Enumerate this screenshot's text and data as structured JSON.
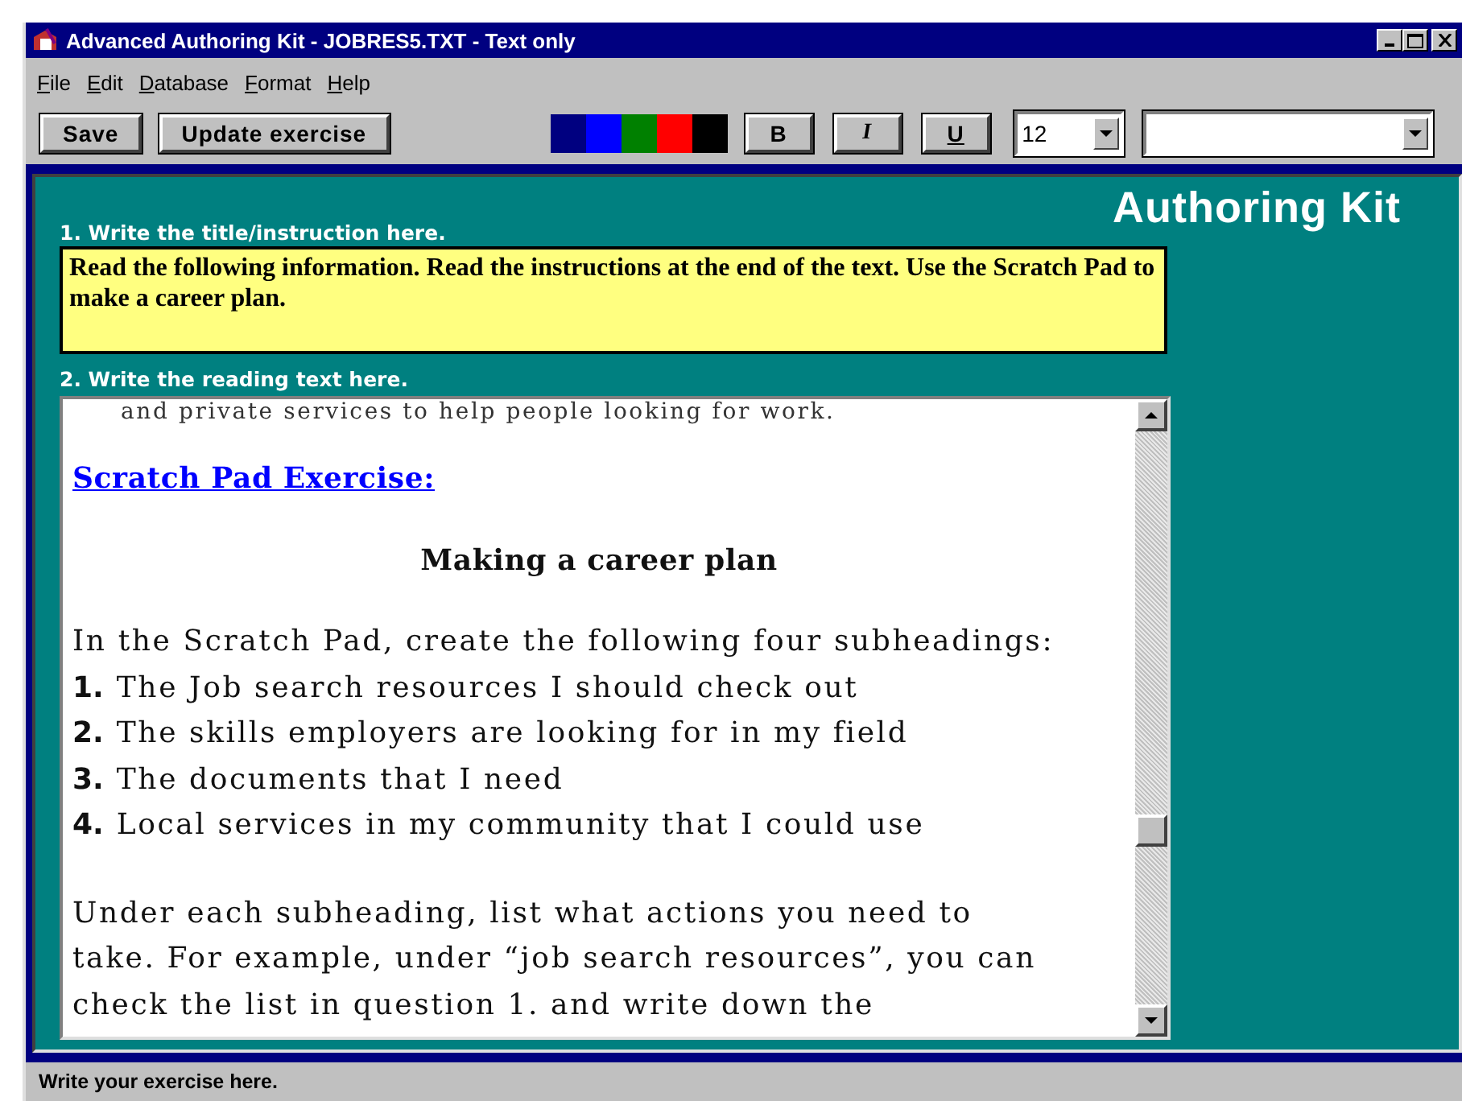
{
  "window": {
    "title": "Advanced Authoring Kit - JOBRES5.TXT - Text only"
  },
  "menu": [
    {
      "label": "File"
    },
    {
      "label": "Edit"
    },
    {
      "label": "Database"
    },
    {
      "label": "Format"
    },
    {
      "label": "Help"
    }
  ],
  "toolbar": {
    "buttons": [
      {
        "label": "Save"
      },
      {
        "label": "Update exercise"
      }
    ],
    "color_swatches": [
      {
        "color": "#000080"
      },
      {
        "color": "#0000ff"
      },
      {
        "color": "#008000"
      },
      {
        "color": "#ff0000"
      },
      {
        "color": "#000000"
      }
    ],
    "format_buttons": [
      {
        "label": "B",
        "kind": "bold"
      },
      {
        "label": "I",
        "kind": "italic"
      },
      {
        "label": "U",
        "kind": "underline"
      }
    ],
    "font_size": {
      "value": "12"
    }
  },
  "panel": {
    "brand": "Authoring Kit",
    "title_label": "1. Write the title/instruction here.",
    "title_text": "Read the following information.  Read the instructions at the end of the text.  Use the Scratch Pad to make a career plan.",
    "reading_label": "2. Write the reading text here.",
    "reading_text": [
      {
        "kind": "text",
        "text": "and private services to help people looking for work."
      },
      {
        "kind": "link",
        "text": "Scratch Pad Exercise:"
      },
      {
        "kind": "heading",
        "text": "Making a career plan"
      },
      {
        "kind": "text",
        "text": "In the Scratch Pad, create the following four subheadings:"
      },
      {
        "kind": "numbered",
        "number": "1.",
        "text": "The Job search resources I should check out"
      },
      {
        "kind": "numbered",
        "number": "2.",
        "text": "The skills employers are looking for in my field"
      },
      {
        "kind": "numbered",
        "number": "3.",
        "text": "The documents that I need"
      },
      {
        "kind": "numbered",
        "number": "4.",
        "text": "Local services in my community that I could use"
      },
      {
        "kind": "paragraph",
        "text": "Under each subheading, list what actions you need to take.  For example, under “job search resources”, you can check the list in question 1. and write down the"
      }
    ]
  },
  "status_bar": {
    "text": "Write your exercise here."
  }
}
